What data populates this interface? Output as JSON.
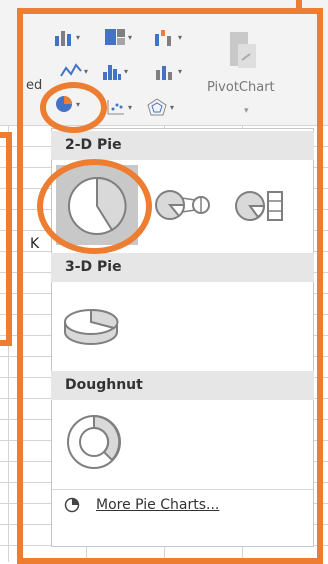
{
  "ribbon": {
    "partial_label": "ed",
    "pivotchart_label": "PivotChart"
  },
  "sheet": {
    "cell_k": "K"
  },
  "menu": {
    "section_2d": "2-D Pie",
    "section_3d": "3-D Pie",
    "section_doughnut": "Doughnut",
    "more_label": "More Pie Charts..."
  },
  "colors": {
    "highlight": "#ed7d31",
    "selected_bg": "#c8c8c8",
    "pie_fill": "#d9d9d9"
  }
}
